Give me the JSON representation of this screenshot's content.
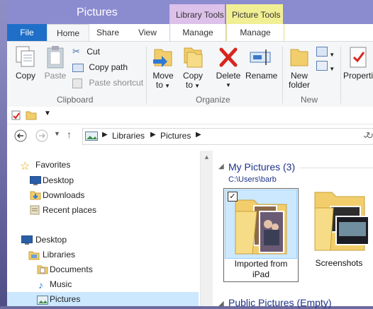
{
  "window": {
    "title": "Pictures",
    "context_tabs": [
      {
        "title": "Library Tools",
        "color": "#dcc1ea"
      },
      {
        "title": "Picture Tools",
        "color": "#f1ef93"
      }
    ]
  },
  "tabs": {
    "file": "File",
    "home": "Home",
    "share": "Share",
    "view": "View",
    "manage_library": "Manage",
    "manage_picture": "Manage"
  },
  "ribbon": {
    "clipboard": {
      "label": "Clipboard",
      "copy": "Copy",
      "paste": "Paste",
      "cut": "Cut",
      "copy_path": "Copy path",
      "paste_shortcut": "Paste shortcut"
    },
    "organize": {
      "label": "Organize",
      "move_to": [
        "Move",
        "to"
      ],
      "copy_to": [
        "Copy",
        "to"
      ],
      "delete": "Delete",
      "rename": "Rename"
    },
    "new": {
      "label": "New",
      "new_folder": [
        "New",
        "folder"
      ]
    },
    "open": {
      "properties": "Properti"
    }
  },
  "address": {
    "crumbs": [
      "Libraries",
      "Pictures"
    ]
  },
  "nav_pane": {
    "favorites": {
      "label": "Favorites",
      "items": [
        "Desktop",
        "Downloads",
        "Recent places"
      ]
    },
    "desktop": {
      "label": "Desktop",
      "libraries": "Libraries",
      "library_items": [
        "Documents",
        "Music",
        "Pictures"
      ]
    }
  },
  "content": {
    "group_title": "My Pictures (3)",
    "group_path": "C:\\Users\\barb",
    "tiles": [
      {
        "label": [
          "Imported from",
          "iPad"
        ],
        "selected": true
      },
      {
        "label": [
          "Screenshots"
        ],
        "selected": false
      }
    ],
    "next_group_title": "Public Pictures (Empty)"
  },
  "colors": {
    "accent": "#1f6fc8",
    "titlebar": "#8b8bd0",
    "selection": "#cce8ff",
    "group_text": "#1e3287"
  }
}
